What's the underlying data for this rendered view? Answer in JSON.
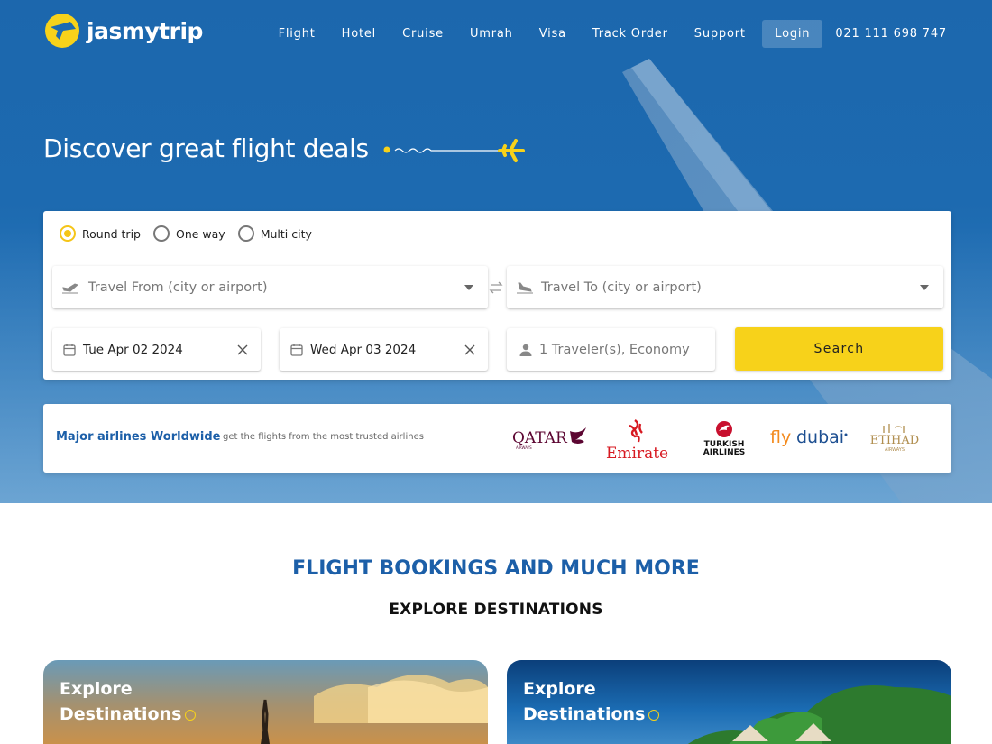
{
  "brand": {
    "name": "jasmytrip"
  },
  "nav": {
    "items": [
      "Flight",
      "Hotel",
      "Cruise",
      "Umrah",
      "Visa",
      "Track Order",
      "Support"
    ],
    "login": "Login",
    "phone": "021 111 698 747"
  },
  "hero": {
    "headline": "Discover great flight deals"
  },
  "search": {
    "trip_types": [
      {
        "label": "Round trip",
        "selected": true
      },
      {
        "label": "One way",
        "selected": false
      },
      {
        "label": "Multi city",
        "selected": false
      }
    ],
    "from_placeholder": "Travel From (city or airport)",
    "to_placeholder": "Travel To (city or airport)",
    "depart_date": "Tue Apr 02 2024",
    "return_date": "Wed Apr 03 2024",
    "travelers_placeholder": "1 Traveler(s), Economy",
    "search_label": "Search"
  },
  "airlines": {
    "title": "Major airlines Worldwide",
    "subtitle": "get the flights from the most trusted airlines",
    "logos": [
      "QATAR",
      "Emirates",
      "TURKISH AIRLINES",
      "flydubai",
      "ETIHAD"
    ]
  },
  "section": {
    "title": "FLIGHT BOOKINGS AND MUCH MORE",
    "subtitle": "EXPLORE DESTINATIONS"
  },
  "destinations": [
    {
      "line1": "Explore",
      "line2": "Destinations"
    },
    {
      "line1": "Explore",
      "line2": "Destinations"
    }
  ],
  "colors": {
    "primary": "#1c5fa8",
    "accent": "#f7d21a",
    "hero": "#1d6ab0"
  }
}
